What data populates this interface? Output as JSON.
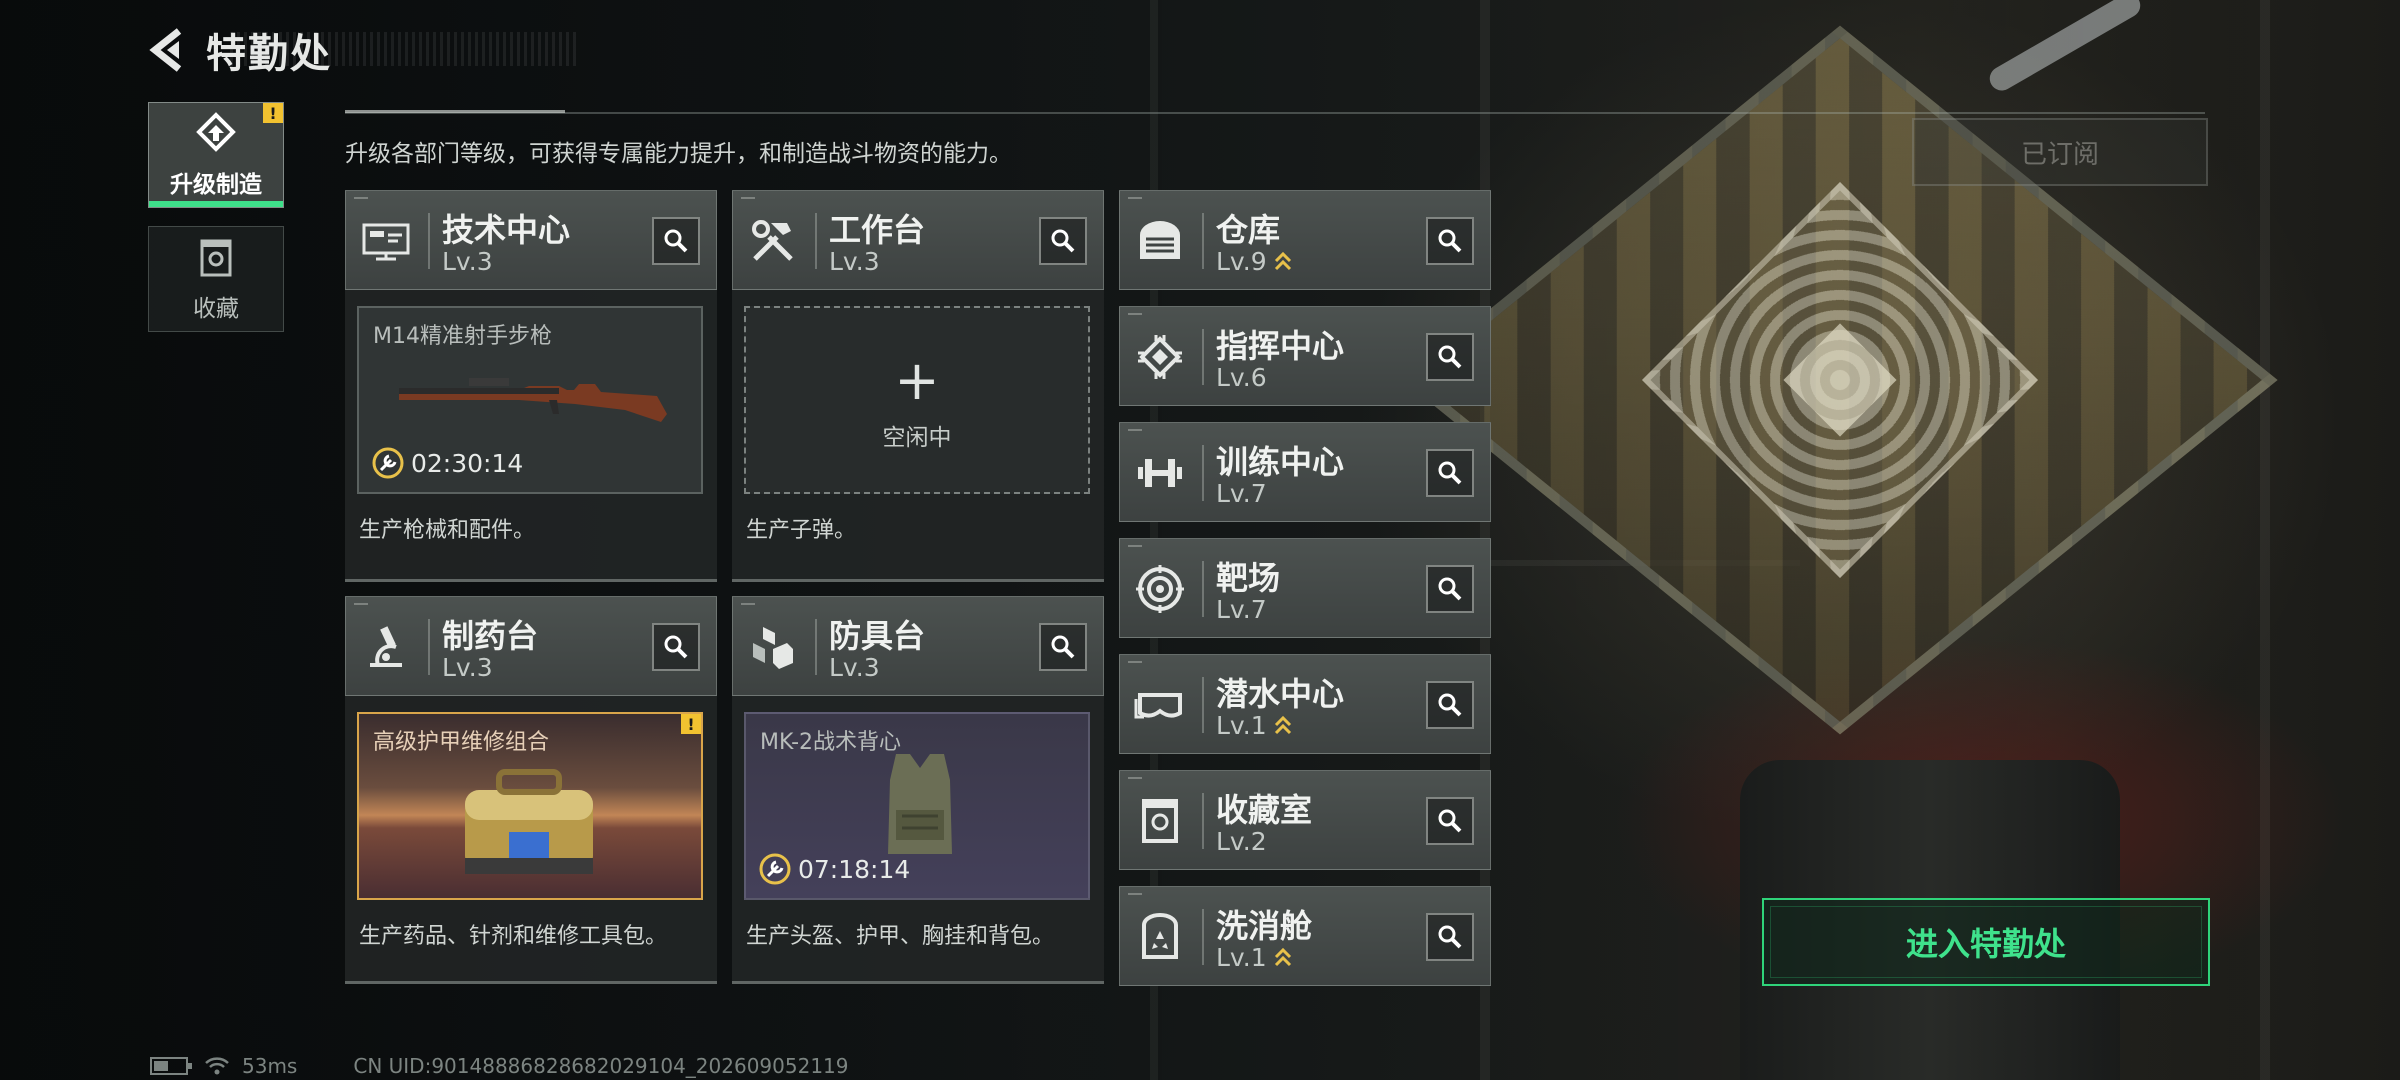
{
  "header": {
    "title": "特勤处"
  },
  "nav": {
    "items": [
      {
        "label": "升级制造",
        "active": true,
        "badge": "!"
      },
      {
        "label": "收藏",
        "active": false
      }
    ]
  },
  "description": "升级各部门等级，可获得专属能力提升，和制造战斗物资的能力。",
  "subscribe_label": "已订阅",
  "production": {
    "tech_center": {
      "name": "技术中心",
      "level": "Lv.3",
      "slot_title": "M14精准射手步枪",
      "timer": "02:30:14",
      "desc": "生产枪械和配件。"
    },
    "workbench": {
      "name": "工作台",
      "level": "Lv.3",
      "plus": "+",
      "idle": "空闲中",
      "desc": "生产子弹。"
    },
    "pharmacy": {
      "name": "制药台",
      "level": "Lv.3",
      "slot_title": "高级护甲维修组合",
      "badge": "!",
      "desc": "生产药品、针剂和维修工具包。"
    },
    "armor_bench": {
      "name": "防具台",
      "level": "Lv.3",
      "slot_title": "MK-2战术背心",
      "timer": "07:18:14",
      "desc": "生产头盔、护甲、胸挂和背包。"
    }
  },
  "facilities": [
    {
      "name": "仓库",
      "level": "Lv.9",
      "upgradable": true,
      "icon": "garage-icon"
    },
    {
      "name": "指挥中心",
      "level": "Lv.6",
      "upgradable": false,
      "icon": "chip-icon"
    },
    {
      "name": "训练中心",
      "level": "Lv.7",
      "upgradable": false,
      "icon": "dumbbell-icon"
    },
    {
      "name": "靶场",
      "level": "Lv.7",
      "upgradable": false,
      "icon": "target-icon"
    },
    {
      "name": "潜水中心",
      "level": "Lv.1",
      "upgradable": true,
      "icon": "goggles-icon"
    },
    {
      "name": "收藏室",
      "level": "Lv.2",
      "upgradable": false,
      "icon": "display-case-icon"
    },
    {
      "name": "洗消舱",
      "level": "Lv.1",
      "upgradable": true,
      "icon": "hazmat-icon"
    }
  ],
  "enter_button": "进入特勤处",
  "footer": {
    "ping": "53ms",
    "uid": "CN UID:90148886828682029104_202609052119"
  },
  "colors": {
    "accent_green": "#3fe28c",
    "badge_yellow": "#f2c230",
    "upgrade_gold": "#e8c14a",
    "orange_slot_border": "#d9a54a"
  }
}
